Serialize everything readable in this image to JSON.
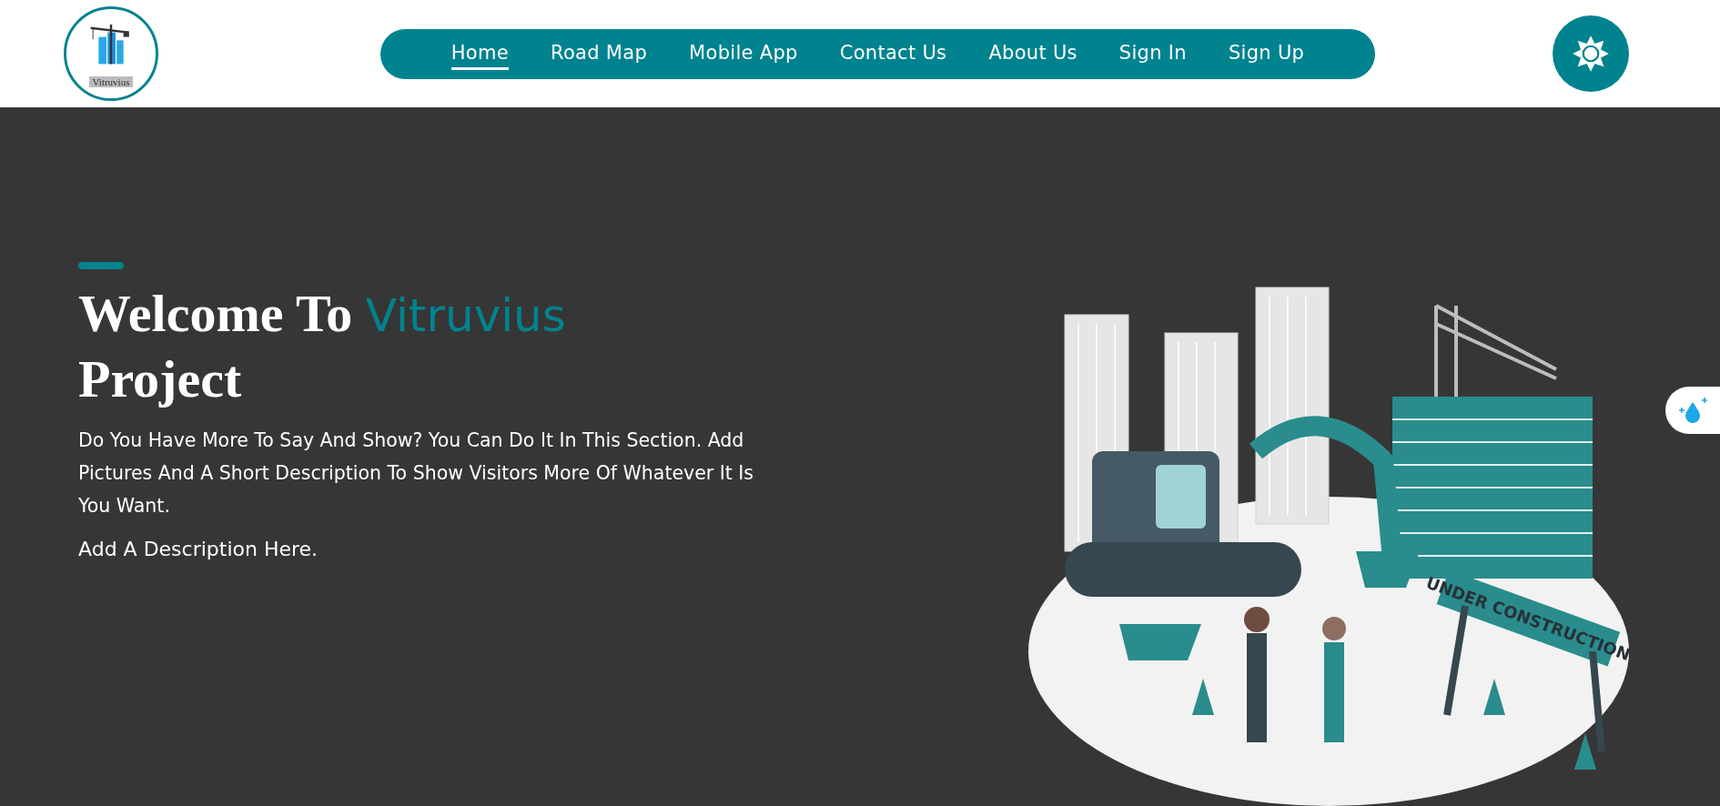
{
  "header": {
    "logo": {
      "text": "Vitruvius"
    },
    "nav": [
      {
        "label": "Home",
        "selected": true
      },
      {
        "label": "Road Map",
        "selected": false
      },
      {
        "label": "Mobile App",
        "selected": false
      },
      {
        "label": "Contact Us",
        "selected": false
      },
      {
        "label": "About Us",
        "selected": false
      },
      {
        "label": "Sign In",
        "selected": false
      },
      {
        "label": "Sign Up",
        "selected": false
      }
    ]
  },
  "hero": {
    "title": [
      {
        "text": "Welcome To",
        "highlight": false
      },
      {
        "text": "Vitruvius",
        "highlight": true
      },
      {
        "text": "Project",
        "highlight": false
      }
    ],
    "paragraphs": [
      "Do You Have More To Say And Show? You Can Do It In This Section. Add Pictures And A Short Description To Show Visitors More Of Whatever It Is You Want.",
      "Add A Description Here."
    ],
    "illustration": {
      "sign_text": "UNDER CONSTRUCTION"
    }
  }
}
